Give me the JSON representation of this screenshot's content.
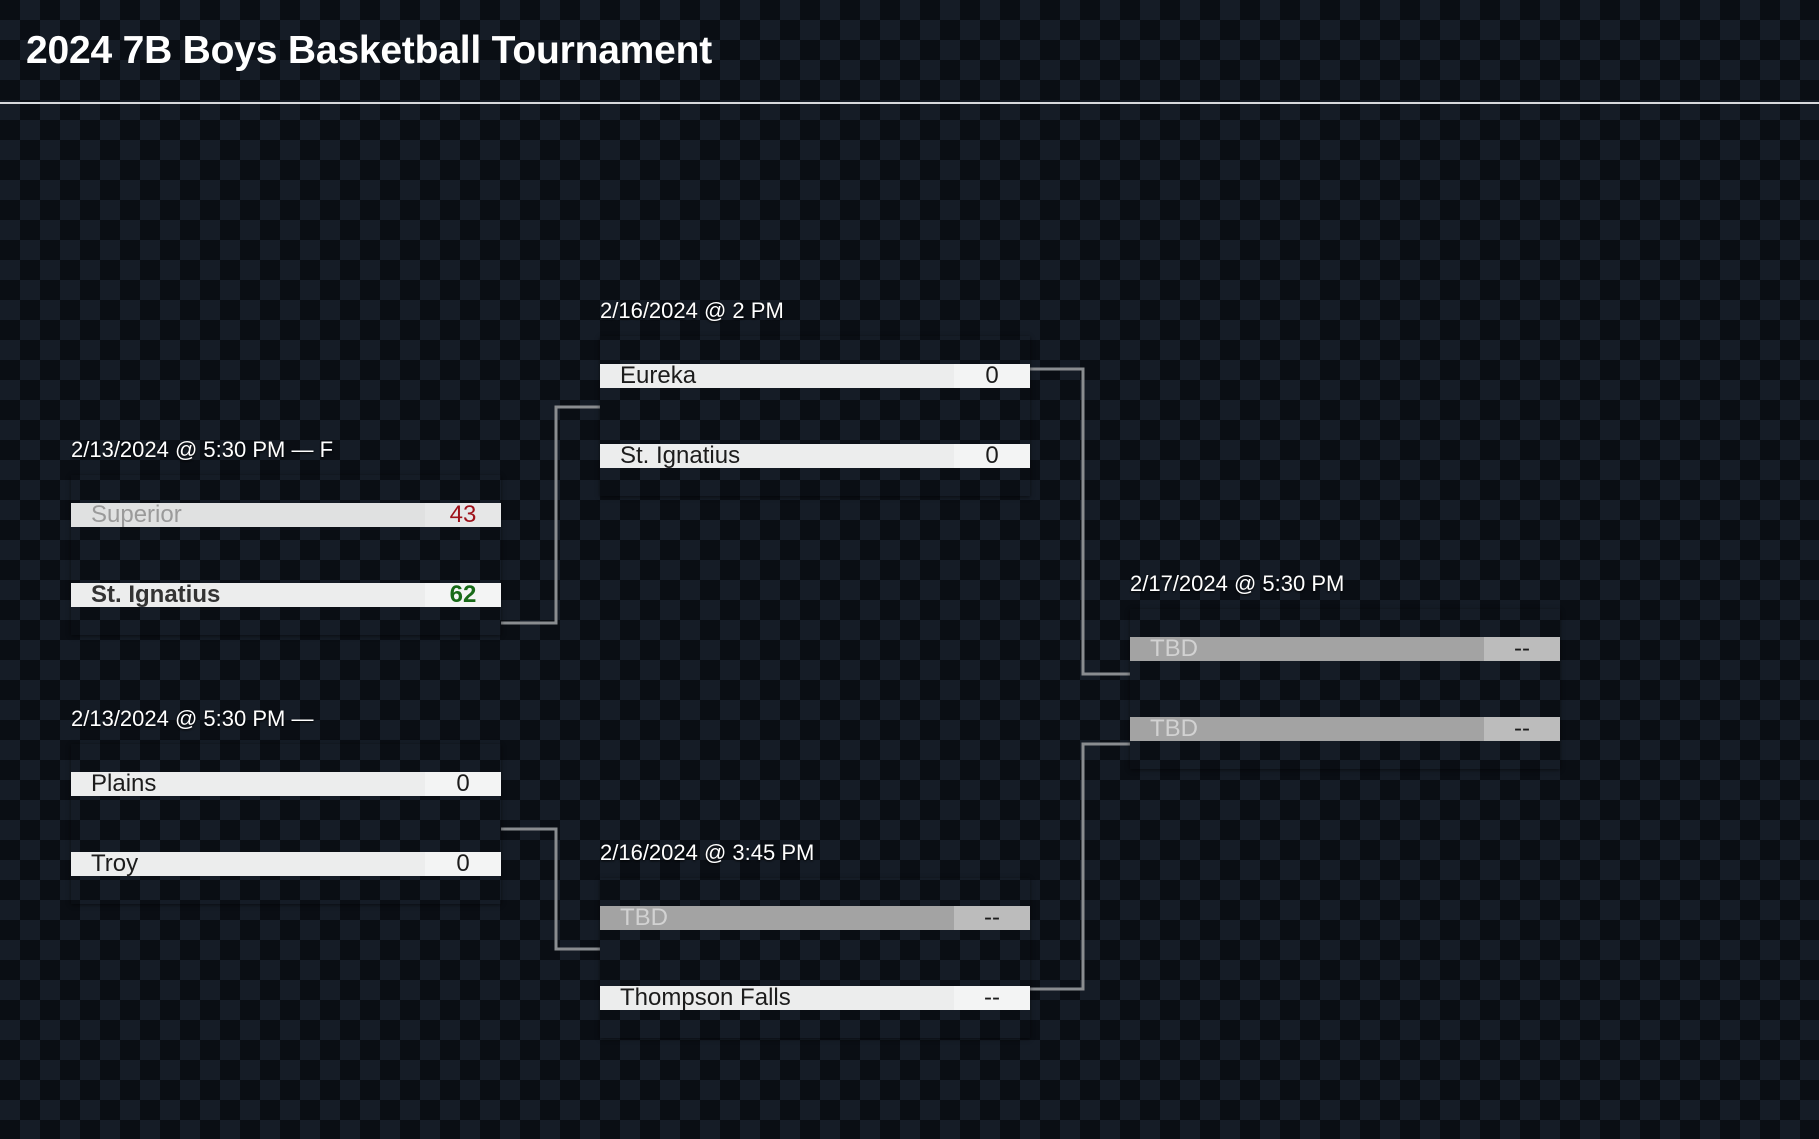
{
  "header": {
    "title": "2024 7B Boys Basketball Tournament"
  },
  "colors": {
    "background": "#0a0e14",
    "pattern": "#151c26",
    "card": "#eceded",
    "card_score": "#f3f4f4",
    "loser_name_bg": "#e0e1e1",
    "tbd_bg": "#a3a3a3",
    "tbd_score_bg": "#bcbcbc",
    "win_score": "#186a18",
    "loss_score": "#9e1119",
    "connector": "#8a8d90",
    "header_rule": "#d8dadd"
  },
  "bracket": {
    "matches": [
      {
        "id": "sf1",
        "label": "2/13/2024 @ 5:30 PM — F",
        "teams": [
          {
            "name": "Superior",
            "score": "43",
            "state": "loser"
          },
          {
            "name": "St. Ignatius",
            "score": "62",
            "state": "winner"
          }
        ]
      },
      {
        "id": "sf2",
        "label": "2/13/2024 @ 5:30 PM —",
        "teams": [
          {
            "name": "Plains",
            "score": "0",
            "state": "normal"
          },
          {
            "name": "Troy",
            "score": "0",
            "state": "normal"
          }
        ]
      },
      {
        "id": "qf1",
        "label": "2/16/2024 @ 2 PM",
        "teams": [
          {
            "name": "Eureka",
            "score": "0",
            "state": "normal"
          },
          {
            "name": "St. Ignatius",
            "score": "0",
            "state": "normal"
          }
        ]
      },
      {
        "id": "qf2",
        "label": "2/16/2024 @ 3:45 PM",
        "teams": [
          {
            "name": "TBD",
            "score": "--",
            "state": "tbd"
          },
          {
            "name": "Thompson Falls",
            "score": "--",
            "state": "normal"
          }
        ]
      },
      {
        "id": "final",
        "label": "2/17/2024 @ 5:30 PM",
        "teams": [
          {
            "name": "TBD",
            "score": "--",
            "state": "tbd"
          },
          {
            "name": "TBD",
            "score": "--",
            "state": "tbd"
          }
        ]
      }
    ]
  }
}
